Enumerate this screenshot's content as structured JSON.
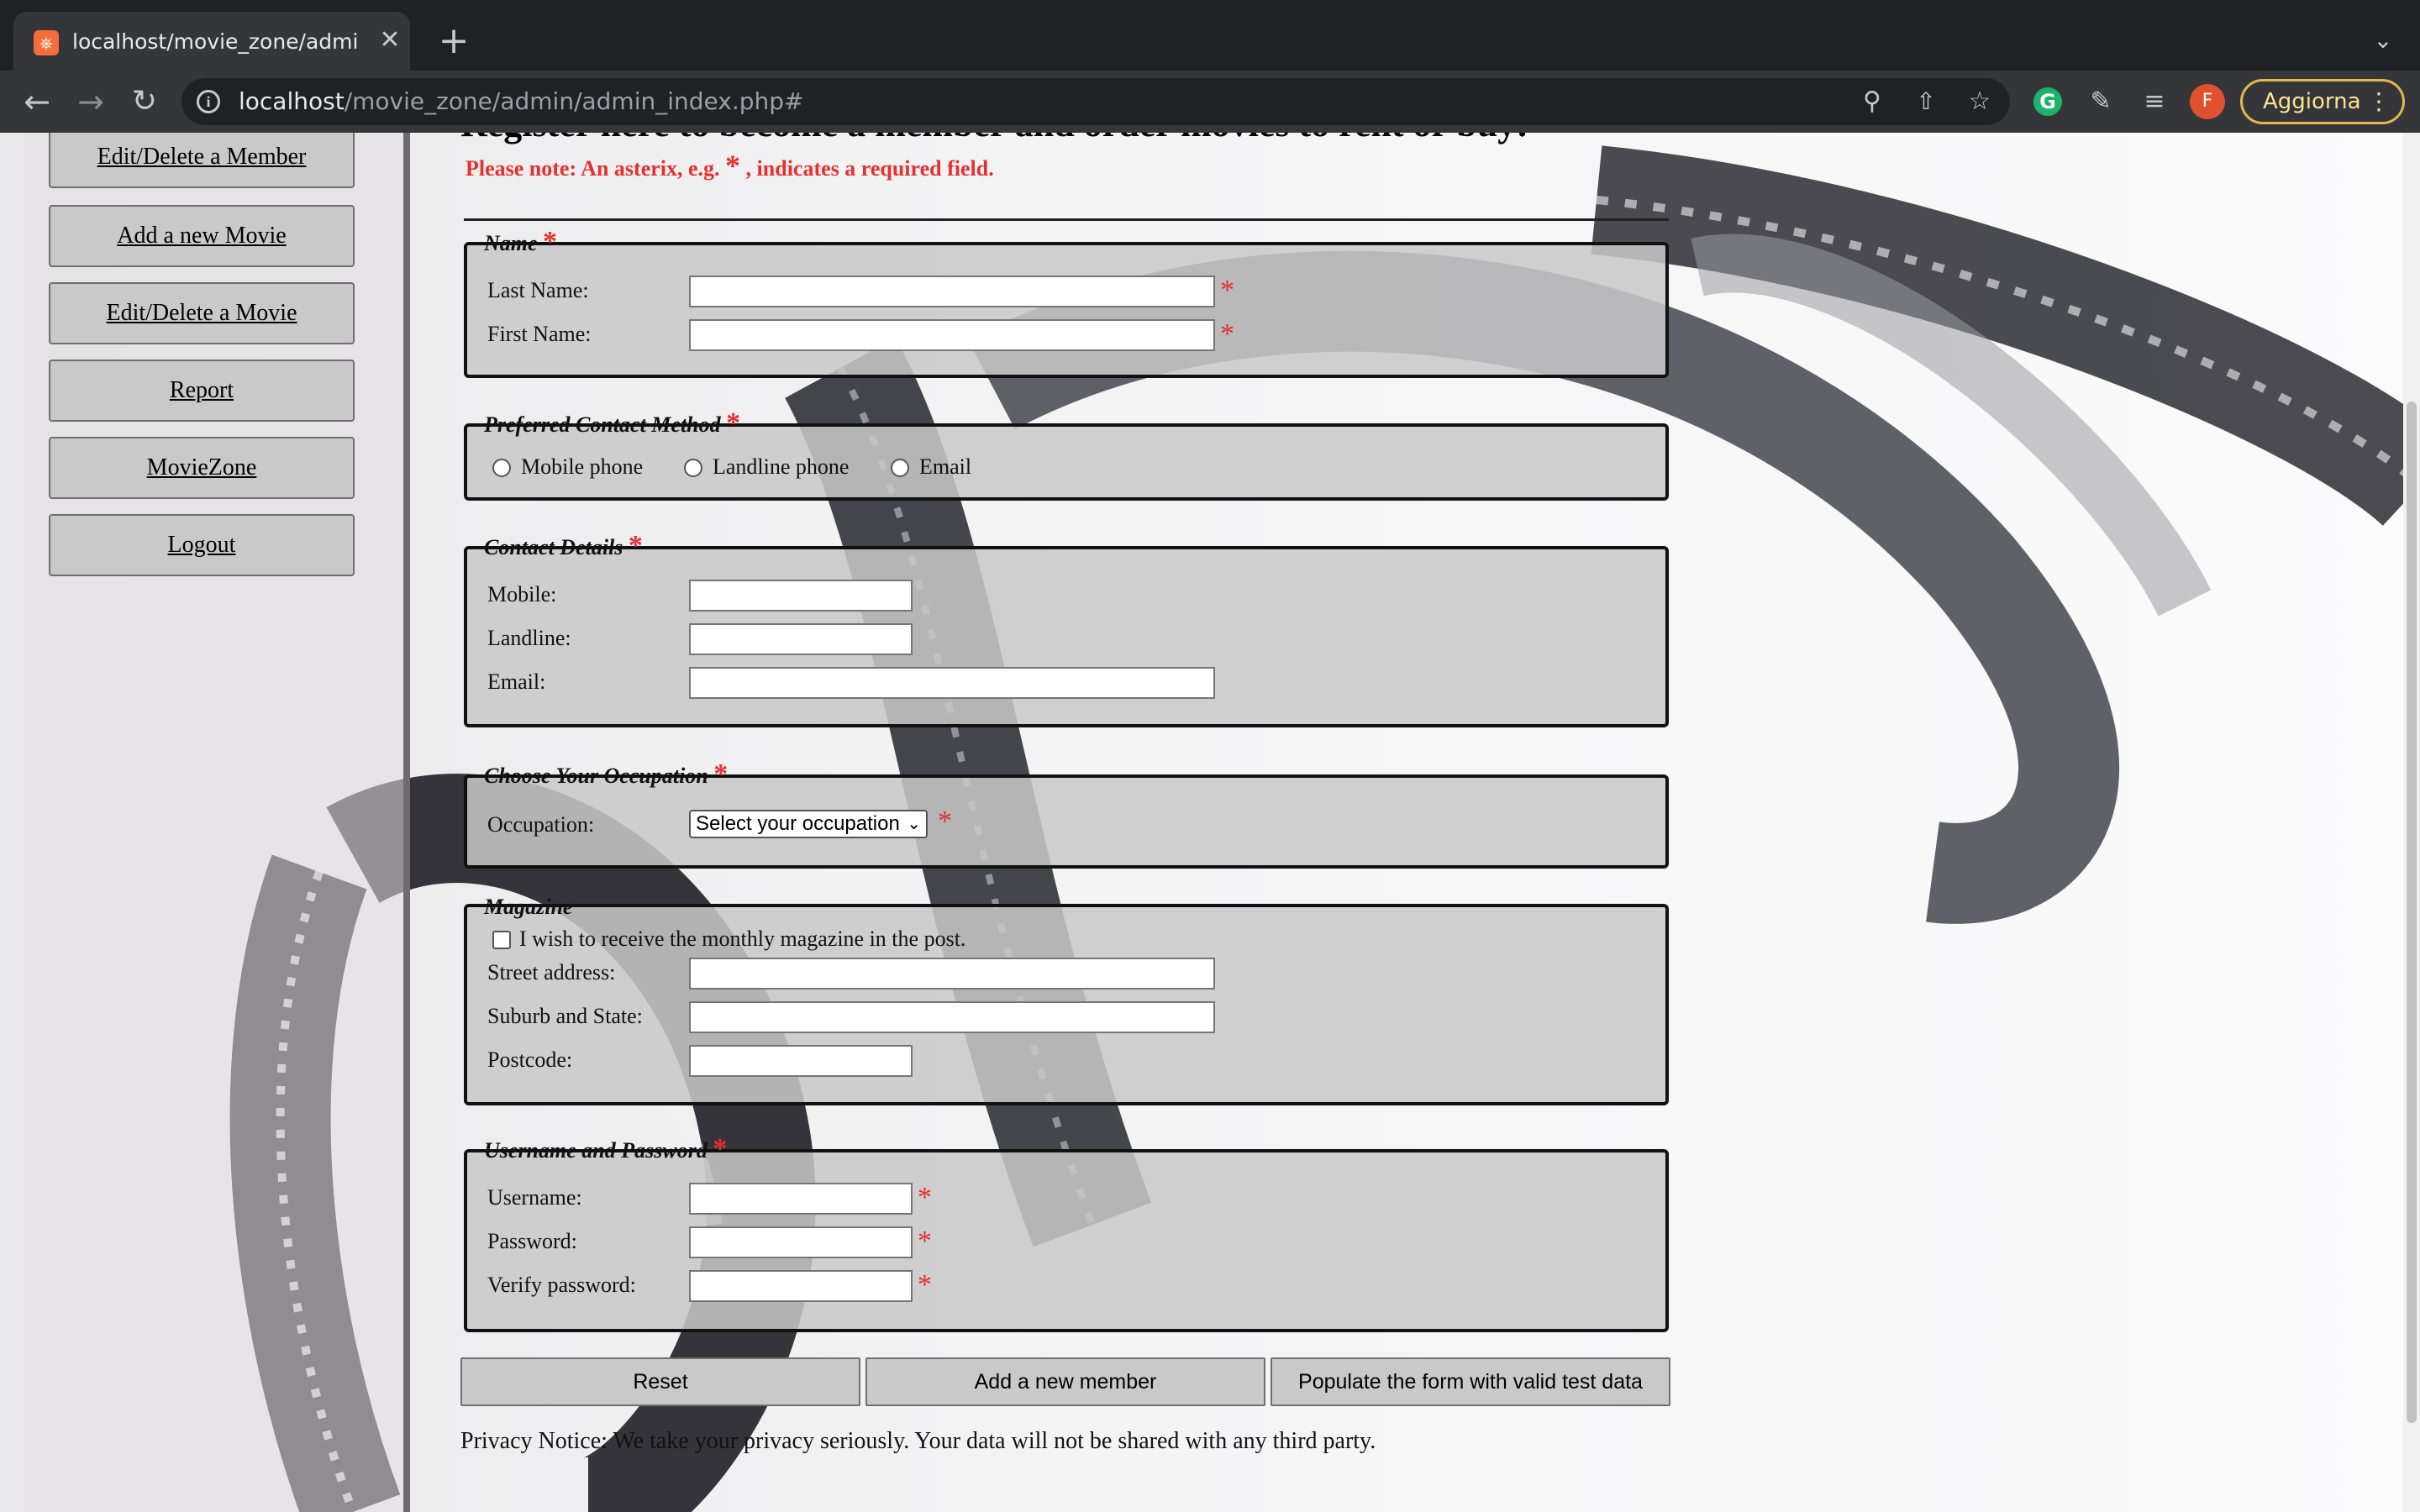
{
  "browser": {
    "tab_title": "localhost/movie_zone/admin/a",
    "tab_favicon": "xampp-icon",
    "url_host": "localhost",
    "url_path": "/movie_zone/admin/admin_index.php#",
    "update_label": "Aggiorna",
    "avatar_letter": "F",
    "extension_g": "G"
  },
  "sidebar": {
    "items": [
      {
        "label": "Edit/Delete a Member"
      },
      {
        "label": "Add a new Movie"
      },
      {
        "label": "Edit/Delete a Movie"
      },
      {
        "label": "Report"
      },
      {
        "label": "MovieZone"
      },
      {
        "label": "Logout"
      }
    ]
  },
  "page": {
    "heading": "Register here to become a member and order movies to rent or buy!",
    "note_prefix": "Please note: An asterix, e.g.",
    "note_suffix": ", indicates a required field.",
    "asterisk": "*"
  },
  "form": {
    "name": {
      "legend": "Name",
      "last_name_label": "Last Name:",
      "first_name_label": "First Name:"
    },
    "contact_method": {
      "legend": "Preferred Contact Method",
      "options": [
        "Mobile phone",
        "Landline phone",
        "Email"
      ]
    },
    "contact_details": {
      "legend": "Contact Details",
      "mobile_label": "Mobile:",
      "landline_label": "Landline:",
      "email_label": "Email:"
    },
    "occupation": {
      "legend": "Choose Your Occupation",
      "label": "Occupation:",
      "selected": "Select your occupation"
    },
    "magazine": {
      "legend": "Magazine",
      "checkbox_label": "I wish to receive the monthly magazine in the post.",
      "street_label": "Street address:",
      "suburb_label": "Suburb and State:",
      "postcode_label": "Postcode:"
    },
    "credentials": {
      "legend": "Username and Password",
      "username_label": "Username:",
      "password_label": "Password:",
      "verify_label": "Verify password:"
    },
    "buttons": {
      "reset": "Reset",
      "add": "Add a new member",
      "populate": "Populate the form with valid test data"
    },
    "privacy": "Privacy Notice: We take your privacy seriously. Your data will not be shared with any third party."
  },
  "colors": {
    "required": "#e53030",
    "chrome_dark": "#1f2125",
    "chrome_toolbar": "#35363a",
    "update_border": "#e2b84b"
  }
}
